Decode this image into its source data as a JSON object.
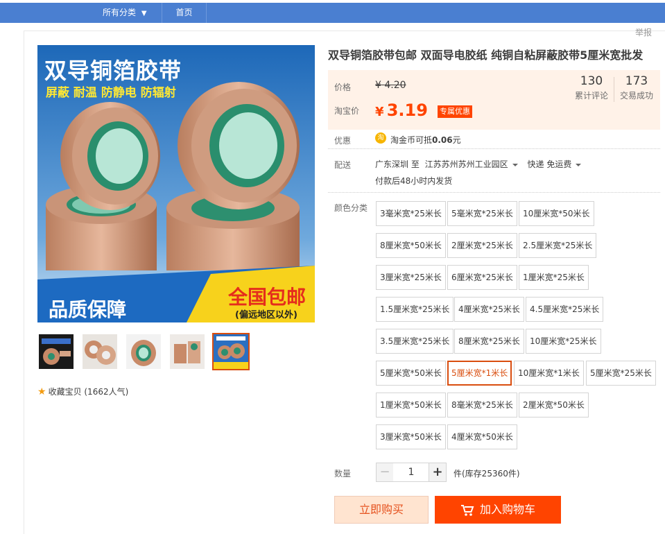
{
  "nav": {
    "category_label": "所有分类",
    "home_label": "首页"
  },
  "report_label": "举报",
  "product": {
    "title": "双导铜箔胶带包邮 双面导电胶纸 纯铜自粘屏蔽胶带5厘米宽批发",
    "banner": {
      "headline": "双导铜箔胶带",
      "subline": "屏蔽 耐温 防静电 防辐射",
      "bottom_left": "品质保障",
      "bottom_right": "全国包邮",
      "bottom_right_note": "(偏远地区以外)"
    },
    "favorite": "收藏宝贝 (1662人气)"
  },
  "price": {
    "orig_label": "价格",
    "orig_currency": "¥",
    "orig_value": "4.20",
    "tb_label": "淘宝价",
    "tb_currency": "¥",
    "tb_value": "3.19",
    "promo_badge": "专属优惠",
    "reviews_count": "130",
    "reviews_label": "累计评论",
    "deals_count": "173",
    "deals_label": "交易成功"
  },
  "youhui": {
    "label": "优惠",
    "coin_icon": "淘",
    "text_prefix": "淘金币可抵",
    "amount": "0.06",
    "unit": "元"
  },
  "delivery": {
    "label": "配送",
    "from": "广东深圳 至",
    "to": "江苏苏州苏州工业园区",
    "method": "快递 免运费",
    "ship_note": "付款后48小时内发货"
  },
  "sku": {
    "label": "颜色分类",
    "options": [
      "3毫米宽*25米长",
      "5毫米宽*25米长",
      "10厘米宽*50米长",
      "8厘米宽*50米长",
      "2厘米宽*25米长",
      "2.5厘米宽*25米长",
      "3厘米宽*25米长",
      "6厘米宽*25米长",
      "1厘米宽*25米长",
      "1.5厘米宽*25米长",
      "4厘米宽*25米长",
      "4.5厘米宽*25米长",
      "3.5厘米宽*25米长",
      "8厘米宽*25米长",
      "10厘米宽*25米长",
      "5厘米宽*50米长",
      "5厘米宽*1米长",
      "10厘米宽*1米长",
      "5厘米宽*25米长",
      "1厘米宽*50米长",
      "8毫米宽*25米长",
      "2厘米宽*50米长",
      "3厘米宽*50米长",
      "4厘米宽*50米长"
    ],
    "selected": "5厘米宽*1米长"
  },
  "quantity": {
    "label": "数量",
    "value": "1",
    "minus": "−",
    "plus": "+",
    "stock": "件(库存25360件)"
  },
  "actions": {
    "buy_now": "立即购买",
    "add_cart": "加入购物车"
  }
}
